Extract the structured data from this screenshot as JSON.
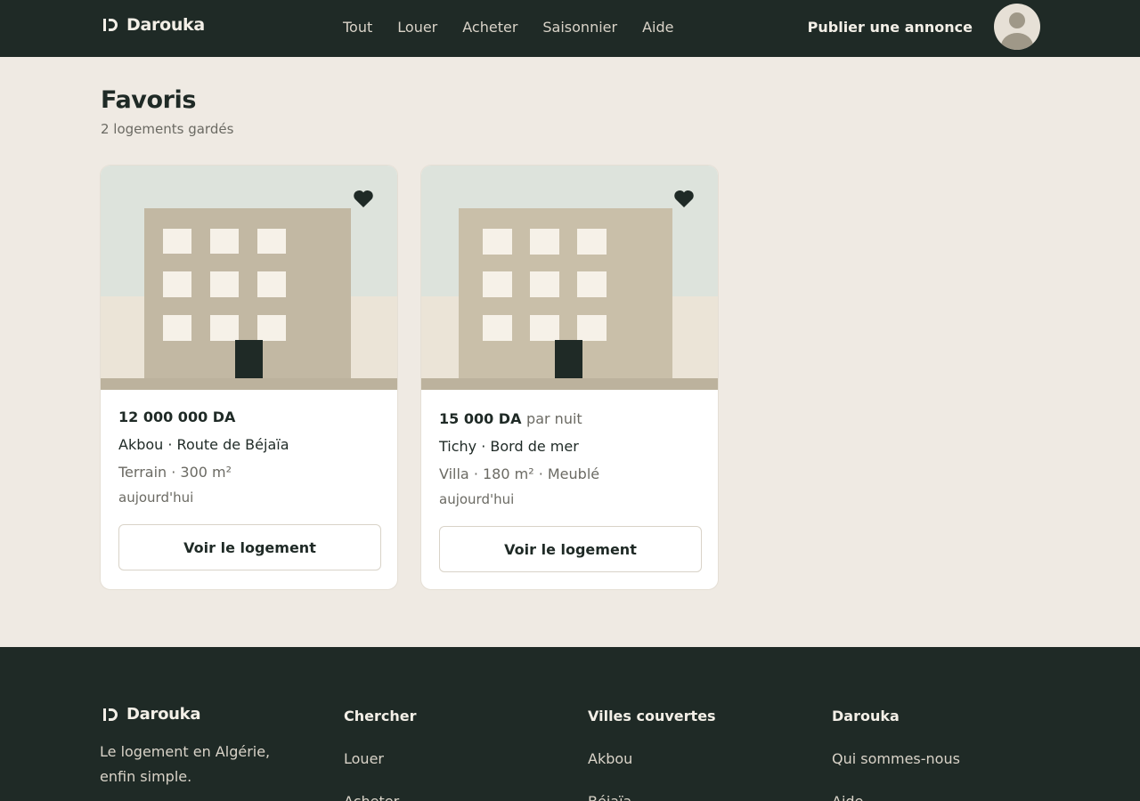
{
  "brand": {
    "name": "Darouka"
  },
  "nav": {
    "items": [
      {
        "label": "Tout"
      },
      {
        "label": "Louer"
      },
      {
        "label": "Acheter"
      },
      {
        "label": "Saisonnier"
      },
      {
        "label": "Aide"
      }
    ],
    "publish_label": "Publier une annonce"
  },
  "page": {
    "title": "Favoris",
    "subtitle": "2 logements gardés"
  },
  "listings": [
    {
      "price": "12 000 000 DA",
      "price_suffix": "",
      "location": "Akbou · Route de Béjaïa",
      "specs": "Terrain · 300 m²",
      "date": "aujourd'hui",
      "button_label": "Voir le logement",
      "favorited": true
    },
    {
      "price": "15 000 DA",
      "price_suffix": "par nuit",
      "location": "Tichy · Bord de mer",
      "specs": "Villa · 180 m² · Meublé",
      "date": "aujourd'hui",
      "button_label": "Voir le logement",
      "favorited": true
    }
  ],
  "footer": {
    "brand": "Darouka",
    "tagline": "Le logement en Algérie, enfin simple.",
    "columns": [
      {
        "title": "Chercher",
        "links": [
          "Louer",
          "Acheter"
        ]
      },
      {
        "title": "Villes couvertes",
        "links": [
          "Akbou",
          "Béjaïa"
        ]
      },
      {
        "title": "Darouka",
        "links": [
          "Qui sommes-nous",
          "Aide"
        ]
      }
    ]
  },
  "colors": {
    "dark": "#1f2a26",
    "background": "#efeae3",
    "sky": "#dde3dc",
    "building": "#c9bfa9",
    "window": "#f6f1e8"
  },
  "icons": {
    "logo": "darouka-logo-icon",
    "favorite": "heart-filled-icon",
    "avatar": "user-avatar-icon"
  }
}
